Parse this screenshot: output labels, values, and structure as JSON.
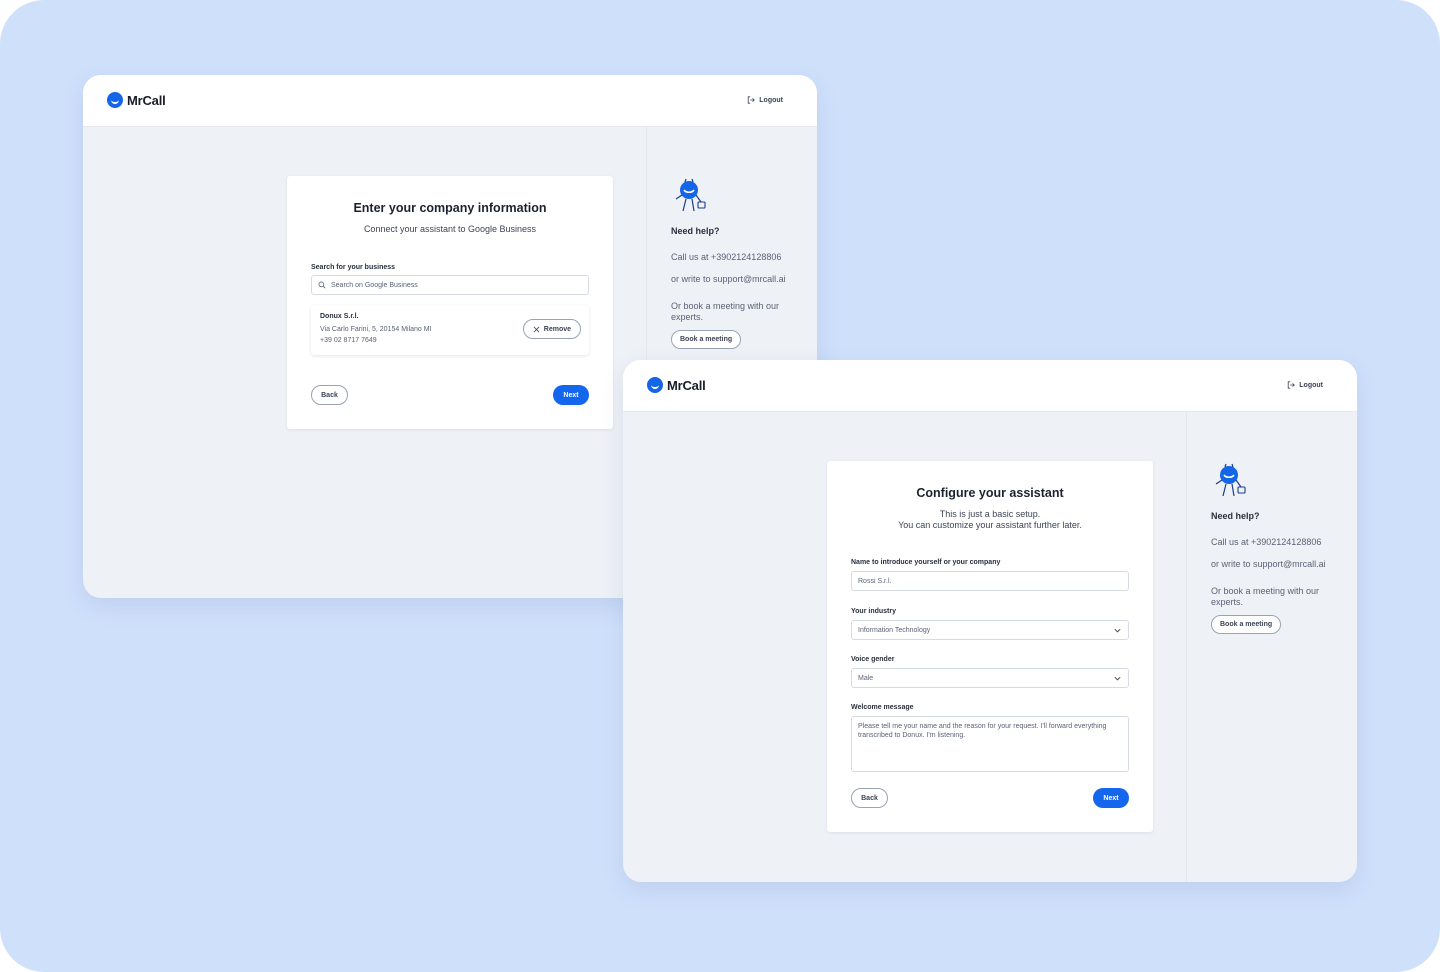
{
  "colors": {
    "background": "#cfe0fb",
    "accent": "#1467ec",
    "panel": "#eef1f6"
  },
  "screen1": {
    "brand": "MrCall",
    "logout_label": "Logout",
    "title": "Enter your company information",
    "subtitle": "Connect your assistant to Google Business",
    "search_label": "Search for your business",
    "search_placeholder": "Search on Google Business",
    "business": {
      "name": "Donux S.r.l.",
      "address": "Via Carlo Farini, 5, 20154 Milano MI",
      "phone": "+39 02 8717 7649",
      "remove_label": "Remove"
    },
    "back_label": "Back",
    "next_label": "Next",
    "help": {
      "title": "Need help?",
      "call": "Call us at +3902124128806",
      "write": "or write to support@mrcall.ai",
      "meeting": "Or book a meeting with our experts.",
      "meeting_button": "Book a meeting"
    }
  },
  "screen2": {
    "brand": "MrCall",
    "logout_label": "Logout",
    "title": "Configure your assistant",
    "subtitle_line1": "This is just a basic setup.",
    "subtitle_line2": "You can customize your assistant further later.",
    "name_label": "Name to introduce yourself or your company",
    "name_value": "Rossi S.r.l.",
    "industry_label": "Your industry",
    "industry_value": "Information Technology",
    "gender_label": "Voice gender",
    "gender_value": "Male",
    "welcome_label": "Welcome message",
    "welcome_value": "Please tell me your name and the reason for your request. I'll forward everything transcribed to Donux. I'm listening.",
    "back_label": "Back",
    "next_label": "Next",
    "help": {
      "title": "Need help?",
      "call": "Call us at +3902124128806",
      "write": "or write to support@mrcall.ai",
      "meeting": "Or book a meeting with our experts.",
      "meeting_button": "Book a meeting"
    }
  }
}
